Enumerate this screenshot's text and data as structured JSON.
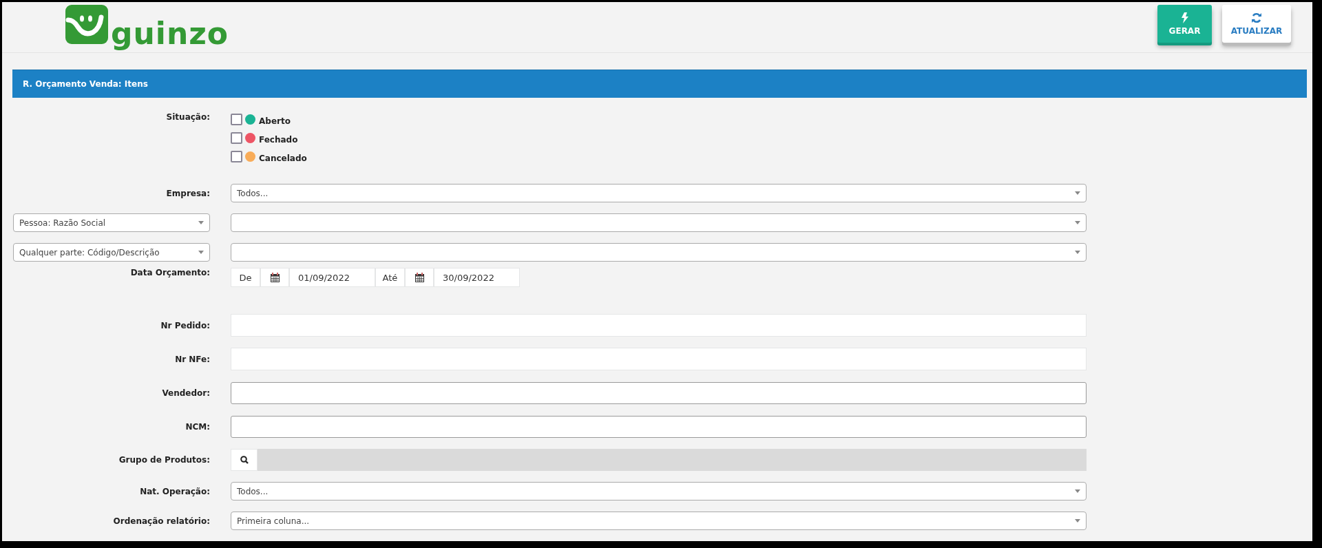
{
  "header": {
    "logo_text": "guinzo",
    "buttons": [
      {
        "kind": "generate",
        "label": "GERAR"
      },
      {
        "kind": "refresh",
        "label": "ATUALIZAR"
      }
    ]
  },
  "panel": {
    "title": "R. Orçamento Venda: Itens"
  },
  "form": [
    {
      "kind": "checks",
      "label": "Situação:",
      "options": [
        {
          "label": "Aberto",
          "checked": false,
          "color": "#1ab394"
        },
        {
          "label": "Fechado",
          "checked": false,
          "color": "#ed5565"
        },
        {
          "label": "Cancelado",
          "checked": false,
          "color": "#f8ac59"
        }
      ]
    },
    {
      "kind": "select",
      "label": "Empresa:",
      "value": "Todos..."
    },
    {
      "kind": "select_pair",
      "selector": "Pessoa: Razão Social"
    },
    {
      "kind": "select_pair",
      "selector": "Qualquer parte: Código/Descrição"
    },
    {
      "kind": "date_range",
      "label": "Data Orçamento:",
      "from_label": "De",
      "from": "01/09/2022",
      "to_label": "Até",
      "to": "30/09/2022"
    },
    {
      "kind": "text_plain",
      "label": "Nr Pedido:"
    },
    {
      "kind": "text_plain",
      "label": "Nr NFe:"
    },
    {
      "kind": "text",
      "label": "Vendedor:"
    },
    {
      "kind": "text",
      "label": "NCM:"
    },
    {
      "kind": "lookup",
      "label": "Grupo de Produtos:"
    },
    {
      "kind": "select",
      "label": "Nat. Operação:",
      "value": "Todos..."
    },
    {
      "kind": "select",
      "label": "Ordenação relatório:",
      "value": "Primeira coluna..."
    }
  ]
}
